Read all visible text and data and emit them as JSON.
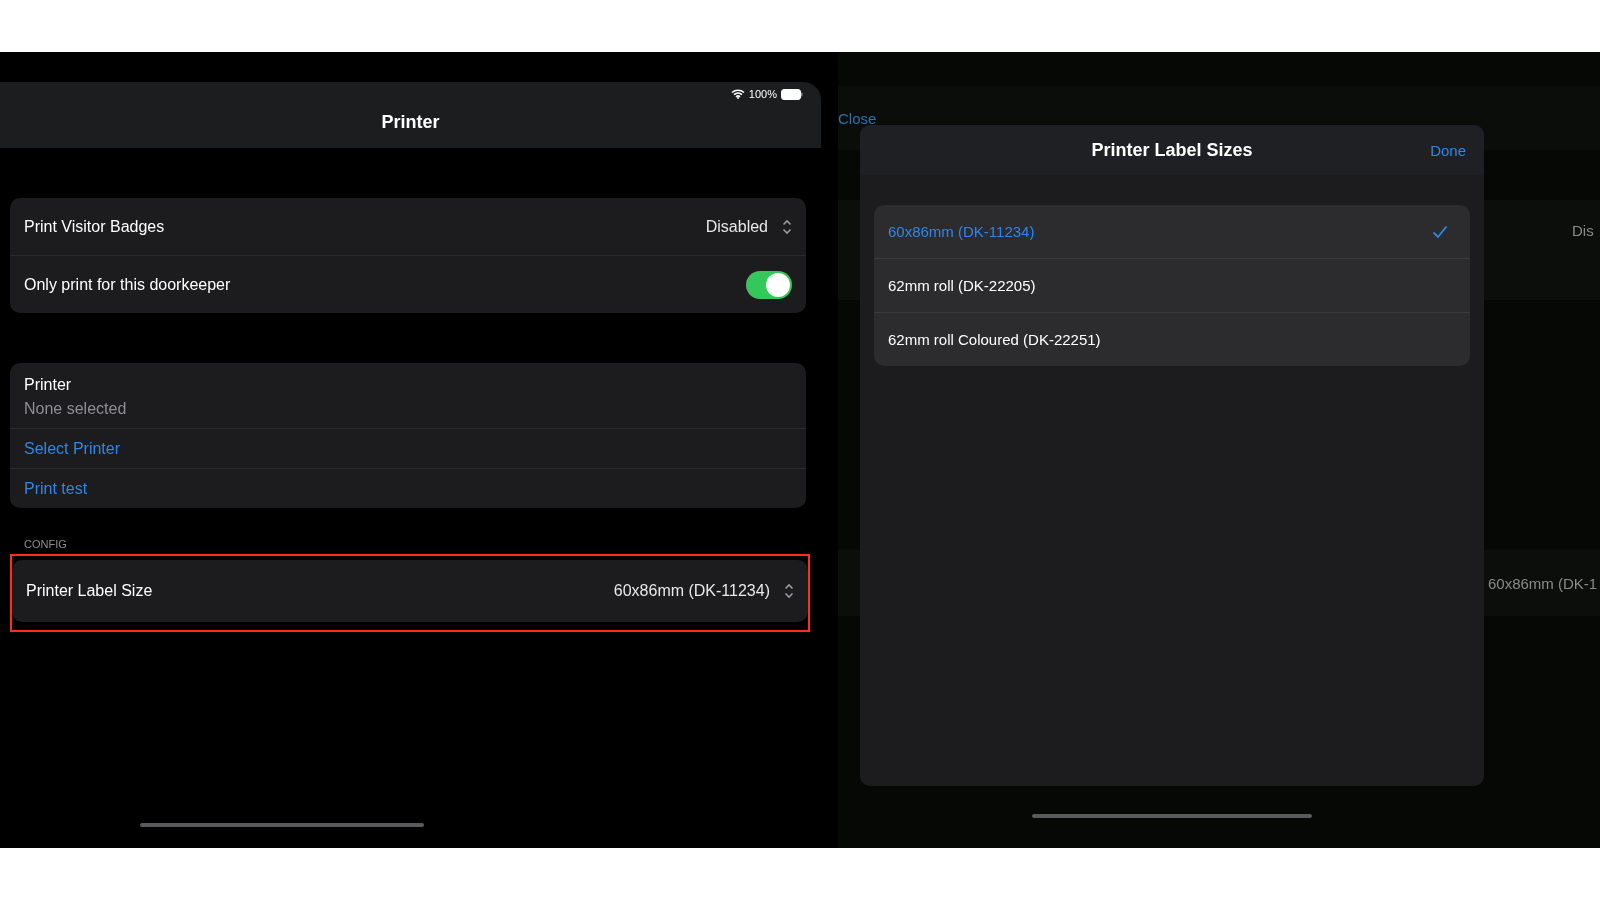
{
  "status_bar": {
    "battery": "100%"
  },
  "nav": {
    "title": "Printer"
  },
  "badge_section": [
    {
      "kind": "select",
      "label": "Print Visitor Badges",
      "value": "Disabled"
    },
    {
      "kind": "toggle",
      "label": "Only print for this doorkeeper",
      "on": true
    }
  ],
  "printer_section": {
    "title": "Printer",
    "subtitle": "None selected",
    "actions": [
      "Select Printer",
      "Print test"
    ]
  },
  "config_section": {
    "header": "CONFIG",
    "rows": [
      {
        "label": "Printer Label Size",
        "value": "60x86mm (DK-11234)",
        "highlighted": true
      }
    ]
  },
  "background": {
    "close": "Close",
    "value_1": "Dis",
    "value_2": "60x86mm (DK-1"
  },
  "modal": {
    "title": "Printer Label Sizes",
    "done": "Done",
    "options": [
      {
        "label": "60x86mm (DK-11234)",
        "selected": true
      },
      {
        "label": "62mm roll (DK-22205)",
        "selected": false
      },
      {
        "label": "62mm roll Coloured (DK-22251)",
        "selected": false
      }
    ]
  }
}
